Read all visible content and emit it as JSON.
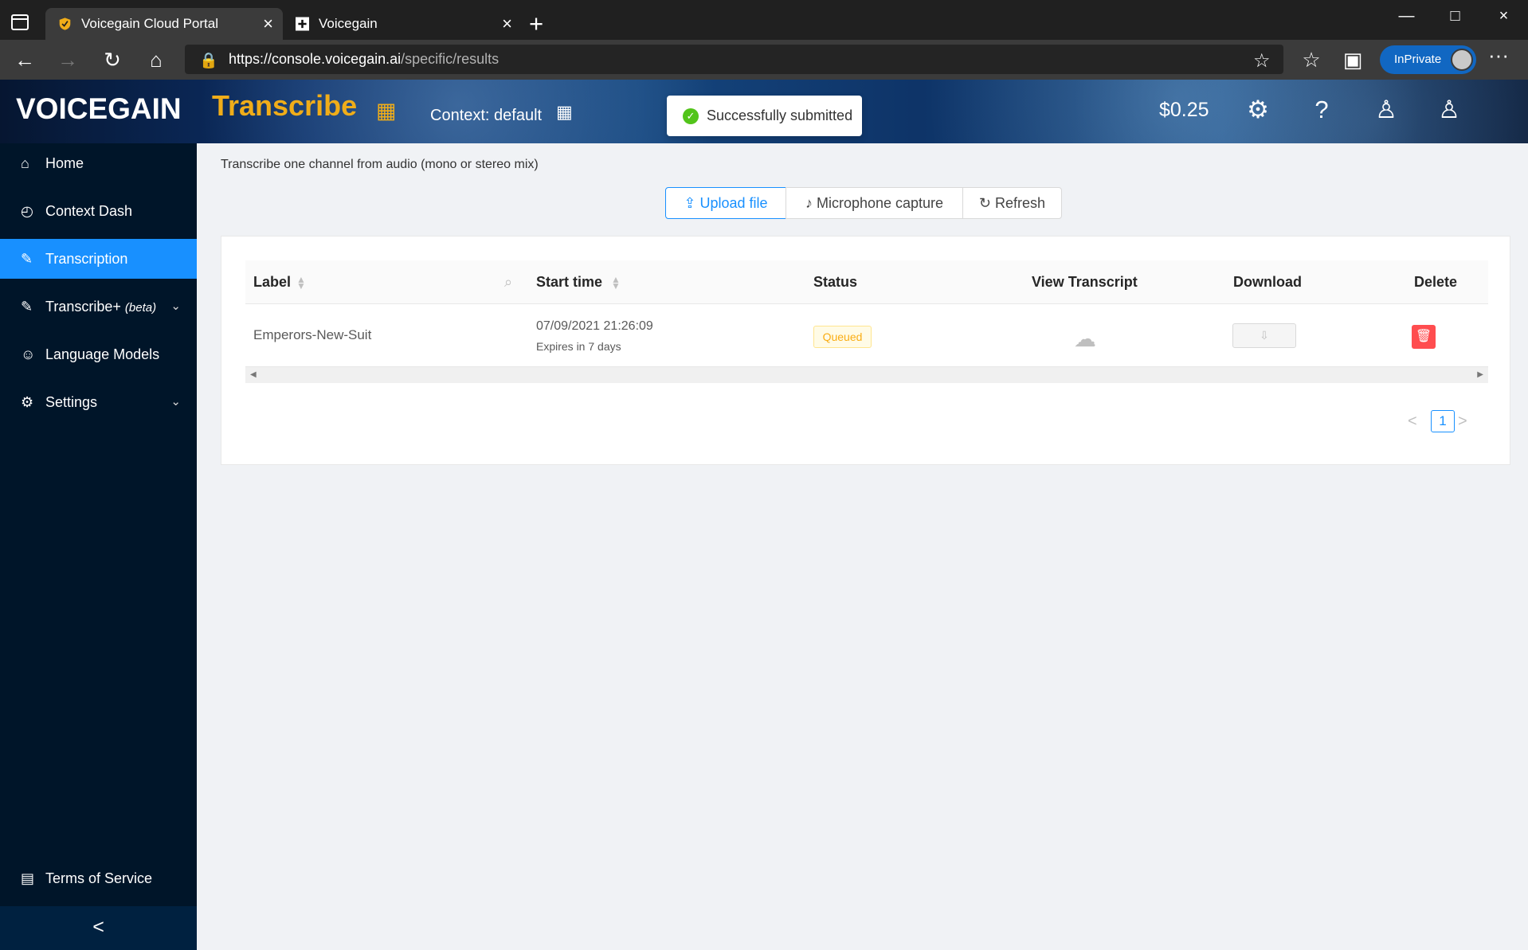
{
  "browser": {
    "tabs": [
      {
        "title": "Voicegain Cloud Portal",
        "close": "×"
      },
      {
        "title": "Voicegain",
        "close": "×"
      }
    ],
    "new_tab": "+",
    "window_controls": [
      "—",
      "□",
      "×"
    ],
    "nav": {
      "back": "←",
      "forward": "→",
      "reload": "↻",
      "home": "⌂"
    },
    "url": {
      "scheme_domain": "https://console.voicegain.ai",
      "path": "/specific/results"
    },
    "address_icons": {
      "favorite": "☆",
      "favorites_list": "☆",
      "collections": "▣"
    },
    "inprivate": "InPrivate",
    "more": "···"
  },
  "header": {
    "brand": "VOICEGAIN",
    "product": "Transcribe",
    "product_grid": "▦",
    "context": "Context: default",
    "context_grid": "▦",
    "toast": "Successfully submitted",
    "credit": "$0.25",
    "icons": {
      "settings": "⚙",
      "help": "?",
      "users": "♙",
      "account": "♙"
    }
  },
  "sidebar": {
    "items": [
      {
        "icon": "⌂",
        "label": "Home"
      },
      {
        "icon": "◴",
        "label": "Context Dash"
      },
      {
        "icon": "✎",
        "label": "Transcription"
      },
      {
        "icon": "✎",
        "label": "Transcribe+",
        "badge": "(beta)",
        "arrow": "⌄"
      },
      {
        "icon": "☺",
        "label": "Language Models"
      },
      {
        "icon": "⚙",
        "label": "Settings",
        "arrow": "⌄"
      }
    ],
    "terms": {
      "icon": "▤",
      "label": "Terms of Service"
    },
    "collapse": "<"
  },
  "main": {
    "intro": "Transcribe one channel from audio (mono or stereo mix)",
    "buttons": {
      "upload": {
        "icon": "⇪",
        "label": "Upload file"
      },
      "microphone": {
        "icon": "♪",
        "label": "Microphone capture"
      },
      "refresh": {
        "icon": "↻",
        "label": "Refresh"
      }
    },
    "table": {
      "columns": [
        "Label",
        "Start time",
        "Status",
        "View Transcript",
        "Download",
        "Delete"
      ],
      "rows": [
        {
          "label": "Emperors-New-Suit",
          "start_time": "07/09/2021 21:26:09",
          "expires": "Expires in 7 days",
          "status": "Queued",
          "view_icon": "☁",
          "download_icon": "⇩",
          "delete_icon": "🗑"
        }
      ]
    },
    "pagination": {
      "prev": "<",
      "page": "1",
      "next": ">"
    }
  }
}
